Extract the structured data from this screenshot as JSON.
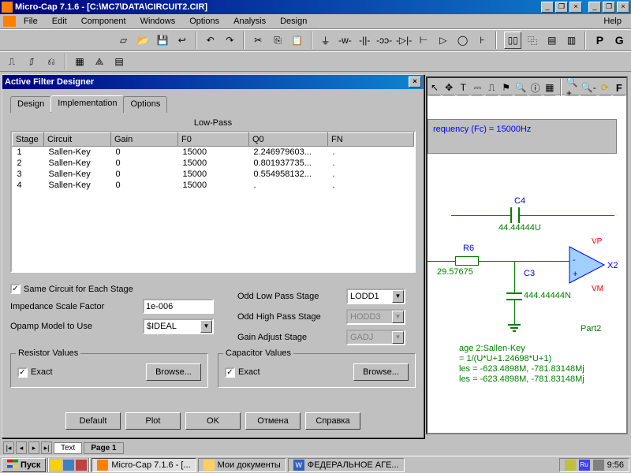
{
  "app": {
    "title": "Micro-Cap 7.1.6 - [C:\\MC7\\DATA\\CIRCUIT2.CIR]"
  },
  "menu": {
    "file": "File",
    "edit": "Edit",
    "component": "Component",
    "windows": "Windows",
    "options": "Options",
    "analysis": "Analysis",
    "design": "Design",
    "help": "Help"
  },
  "dialog": {
    "title": "Active Filter Designer",
    "tabs": {
      "design": "Design",
      "implementation": "Implementation",
      "options": "Options"
    },
    "filter_type": "Low-Pass",
    "cols": {
      "stage": "Stage",
      "circuit": "Circuit",
      "gain": "Gain",
      "f0": "F0",
      "q0": "Q0",
      "fn": "FN"
    },
    "rows": [
      {
        "stage": "1",
        "circuit": "Sallen-Key",
        "gain": "0",
        "f0": "15000",
        "q0": "2.246979603...",
        "fn": "."
      },
      {
        "stage": "2",
        "circuit": "Sallen-Key",
        "gain": "0",
        "f0": "15000",
        "q0": "0.801937735...",
        "fn": "."
      },
      {
        "stage": "3",
        "circuit": "Sallen-Key",
        "gain": "0",
        "f0": "15000",
        "q0": "0.554958132...",
        "fn": "."
      },
      {
        "stage": "4",
        "circuit": "Sallen-Key",
        "gain": "0",
        "f0": "15000",
        "q0": ".",
        "fn": "."
      }
    ],
    "same_circuit": "Same Circuit for Each Stage",
    "impedance_lbl": "Impedance Scale Factor",
    "impedance_val": "1e-006",
    "opamp_lbl": "Opamp Model to Use",
    "opamp_val": "$IDEAL",
    "odd_low_lbl": "Odd Low Pass Stage",
    "odd_low_val": "LODD1",
    "odd_high_lbl": "Odd High Pass Stage",
    "odd_high_val": "HODD3",
    "gain_adj_lbl": "Gain Adjust Stage",
    "gain_adj_val": "GADJ",
    "resistor_group": "Resistor Values",
    "capacitor_group": "Capacitor Values",
    "exact": "Exact",
    "browse": "Browse...",
    "buttons": {
      "default": "Default",
      "plot": "Plot",
      "ok": "OK",
      "cancel": "Отмена",
      "help": "Справка"
    }
  },
  "circuit": {
    "freq_text": "requency (Fc) = 15000Hz",
    "c4_lbl": "C4",
    "c4_val": "44.44444U",
    "r6_lbl": "R6",
    "r6_val": "29.57675",
    "c3_lbl": "C3",
    "c3_val": "444.44444N",
    "x2_lbl": "X2",
    "vp": "VP",
    "vm": "VM",
    "part2": "Part2",
    "stage_lbl": "age 2:Sallen-Key",
    "tf": " = 1/(U*U+1.24698*U+1)",
    "poles1": "les = -623.4898M, -781.83148Mj",
    "poles2": "les = -623.4898M, -781.83148Mj"
  },
  "footer": {
    "text": "Text",
    "page1": "Page 1"
  },
  "taskbar": {
    "start": "Пуск",
    "app1": "Micro-Cap 7.1.6 - [...",
    "app2": "Мои документы",
    "app3": "ФЕДЕРАЛЬНОЕ АГЕ...",
    "lang": "Ru",
    "time": "9:56"
  }
}
